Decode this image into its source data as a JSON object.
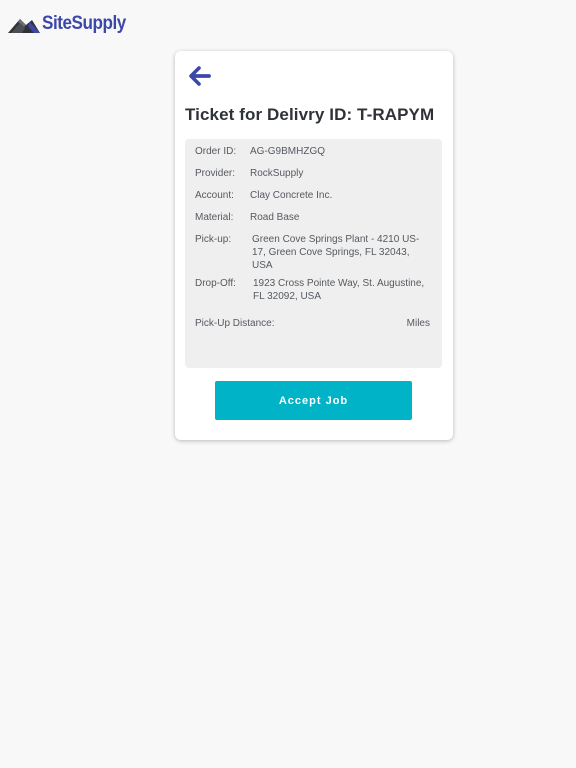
{
  "brand": {
    "name": "SiteSupply",
    "color": "#3d47a8"
  },
  "ticket": {
    "title": "Ticket for Delivry ID: T-RAPYM",
    "back_icon": "arrow-left-icon",
    "fields": {
      "order_id": {
        "label": "Order ID:",
        "value": "AG-G9BMHZGQ"
      },
      "provider": {
        "label": "Provider:",
        "value": "RockSupply"
      },
      "account": {
        "label": "Account:",
        "value": "Clay Concrete Inc."
      },
      "material": {
        "label": "Material:",
        "value": "Road Base"
      },
      "pickup": {
        "label": "Pick-up:",
        "value": "Green Cove Springs Plant - 4210 US-17, Green Cove Springs, FL 32043, USA"
      },
      "dropoff": {
        "label": "Drop-Off:",
        "value": "1923 Cross Pointe Way, St. Augustine, FL 32092, USA"
      },
      "distance": {
        "label": "Pick-Up Distance:",
        "value": "Miles"
      }
    },
    "accept_label": "Accept Job",
    "accent_color": "#00b3c7"
  }
}
